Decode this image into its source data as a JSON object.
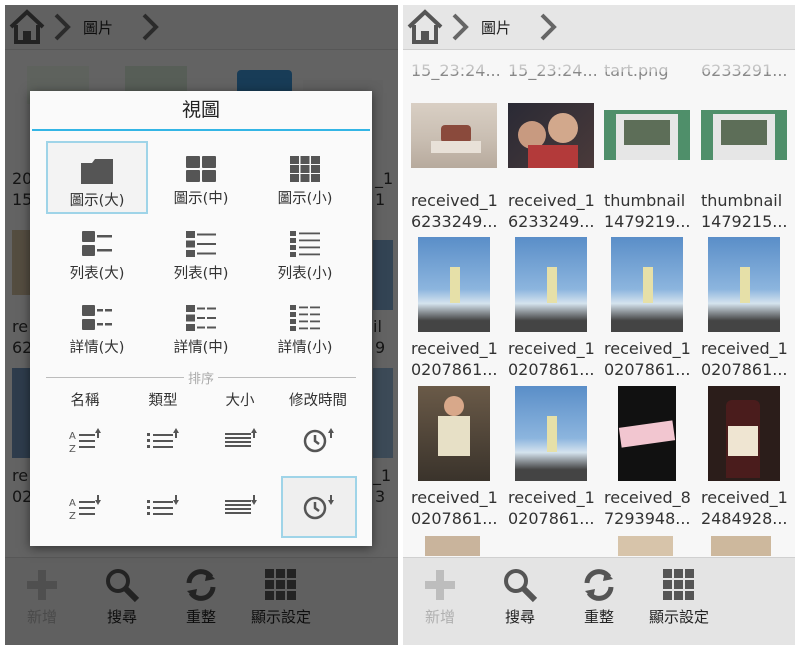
{
  "breadcrumb": {
    "folder": "圖片"
  },
  "dialog": {
    "title": "視圖",
    "options": [
      {
        "label": "圖示(大)"
      },
      {
        "label": "圖示(中)"
      },
      {
        "label": "圖示(小)"
      },
      {
        "label": "列表(大)"
      },
      {
        "label": "列表(中)"
      },
      {
        "label": "列表(小)"
      },
      {
        "label": "詳情(大)"
      },
      {
        "label": "詳情(中)"
      },
      {
        "label": "詳情(小)"
      }
    ],
    "sort_title": "排序",
    "sort_headers": [
      "名稱",
      "類型",
      "大小",
      "修改時間"
    ]
  },
  "toolbar": {
    "add": "新增",
    "search": "搜尋",
    "refresh": "重整",
    "display": "顯示設定"
  },
  "left_bg": {
    "t1a": "20",
    "t1b": "15",
    "t1c": "_1",
    "t1d": "1",
    "t2a": "re",
    "t2b": "62",
    "t2c": "il",
    "t2d": "9",
    "t3a": "re",
    "t3b": "02",
    "t3c": "_1",
    "t3d": "3"
  },
  "files": {
    "row0": [
      "15_23:24...",
      "15_23:24...",
      "tart.png",
      "6233291..."
    ],
    "row1": [
      [
        "received_1",
        "6233249..."
      ],
      [
        "received_1",
        "6233249..."
      ],
      [
        "thumbnail",
        "1479219..."
      ],
      [
        "thumbnail",
        "1479215..."
      ]
    ],
    "row2": [
      [
        "received_1",
        "0207861..."
      ],
      [
        "received_1",
        "0207861..."
      ],
      [
        "received_1",
        "0207861..."
      ],
      [
        "received_1",
        "0207861..."
      ]
    ],
    "row3": [
      [
        "received_1",
        "0207861..."
      ],
      [
        "received_1",
        "0207861..."
      ],
      [
        "received_8",
        "7293948..."
      ],
      [
        "received_1",
        "2484928..."
      ]
    ]
  },
  "colors": {
    "accent": "#33b5e5",
    "selection": "#9fd4e8"
  },
  "icons": [
    "home-icon",
    "chevron-right-icon",
    "plus-icon",
    "search-icon",
    "refresh-icon",
    "grid-icon"
  ]
}
